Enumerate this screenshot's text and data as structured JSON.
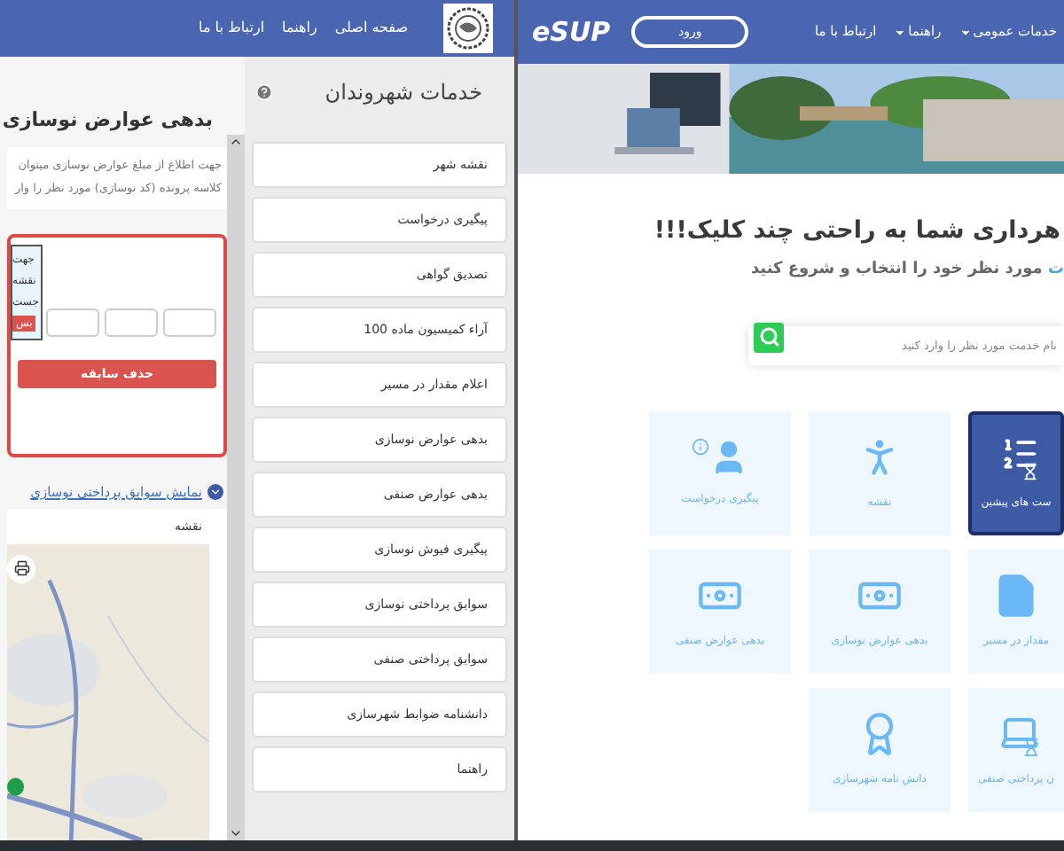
{
  "left": {
    "nav": [
      "صفحه اصلی",
      "راهنما",
      "ارتباط با ما"
    ],
    "services_title": "خدمات شهروندان",
    "services": [
      "نقشه شهر",
      "پیگیری درخواست",
      "تصدیق گواهی",
      "آراء کمیسیون ماده 100",
      "اعلام مقدار در مسیر",
      "بدهی عوارض نوسازی",
      "بدهی عوارض صنفی",
      "پیگیری فیوش نوسازی",
      "سوابق پرداختی نوسازی",
      "سوابق پرداختی صنفی",
      "دانشنامه ضوابط شهرسازی",
      "راهنما"
    ],
    "page_title": "بدهی عوارض نوسازی",
    "description_lines": [
      "جهت اطلاع از مبلغ عوارض نوسازی میتوان",
      "کلاسه پرونده (کد نوسازی) مورد نظر را وار"
    ],
    "tooltip_lines": [
      "جهت",
      "نقشه",
      "جست"
    ],
    "tooltip_button": "بس",
    "delete_button": "حذف سابقه",
    "history_link": "نمایش سوابق پرداختی نوسازی",
    "map_title": "نقشه"
  },
  "right": {
    "logo": "eSUP",
    "login_button": "ورود",
    "nav": [
      {
        "label": "خدمات عمومی",
        "dropdown": true
      },
      {
        "label": "راهنما",
        "dropdown": true
      },
      {
        "label": "ارتباط با ما",
        "dropdown": false
      }
    ],
    "heading": "هرداری شما به راحتی چند کلیک!!!",
    "subtitle_highlight": "ت",
    "subtitle": "مورد نظر خود را انتخاب و شروع کنید",
    "search_placeholder": "نام خدمت مورد نظر را وارد کنید",
    "tiles": [
      {
        "label": "ست های پیشین",
        "kind": "history",
        "selected": true
      },
      {
        "label": "نقشه",
        "kind": "map",
        "selected": false
      },
      {
        "label": "پیگیری درخواست",
        "kind": "request",
        "selected": false
      },
      {
        "label": "مقدار در مسیر",
        "kind": "document",
        "selected": false
      },
      {
        "label": "بدهی عوارض نوسازی",
        "kind": "payment",
        "selected": false
      },
      {
        "label": "بدهی عوارض صنفی",
        "kind": "payment",
        "selected": false
      },
      {
        "label": "ن پرداختی صنفی",
        "kind": "laptop",
        "selected": false
      },
      {
        "label": "دانش نامه شهرسازی",
        "kind": "diploma",
        "selected": false
      }
    ]
  }
}
